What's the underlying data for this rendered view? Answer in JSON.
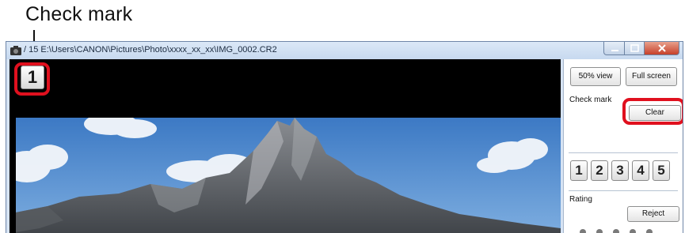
{
  "callout": {
    "label": "Check mark"
  },
  "titlebar": {
    "title": "/ 15  E:\\Users\\CANON\\Pictures\\Photo\\xxxx_xx_xx\\IMG_0002.CR2"
  },
  "viewer": {
    "check_mark_value": "1"
  },
  "side_panel": {
    "view_50_label": "50% view",
    "full_screen_label": "Full screen",
    "check_mark_label": "Check mark",
    "clear_label": "Clear",
    "check_buttons": [
      "1",
      "2",
      "3",
      "4",
      "5"
    ],
    "rating_label": "Rating",
    "reject_label": "Reject",
    "rating_stars": 0
  },
  "colors": {
    "highlight": "#e0101e",
    "close_button": "#c6402a",
    "titlebar": "#c7d9ef"
  }
}
